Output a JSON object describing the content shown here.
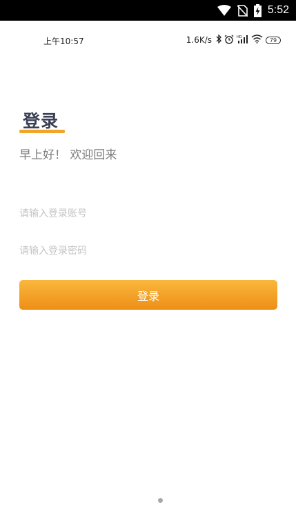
{
  "system_bar": {
    "time": "5:52",
    "icons": [
      "wifi-icon",
      "no-sim-icon",
      "battery-charging-icon"
    ]
  },
  "status_bar": {
    "time": "上午10:57",
    "net_speed": "1.6K/s",
    "battery_level": "79",
    "icons": [
      "bluetooth-icon",
      "alarm-icon",
      "hd-signal-icon",
      "wifi-icon",
      "battery-icon"
    ]
  },
  "login": {
    "title": "登录",
    "greeting": "早上好！ 欢迎回来",
    "account_placeholder": "请输入登录账号",
    "password_placeholder": "请输入登录密码",
    "submit_label": "登录"
  },
  "colors": {
    "accent": "#f0a62b",
    "button_top": "#f9b73d",
    "button_bottom": "#ee8e16",
    "title": "#3a3f55"
  }
}
